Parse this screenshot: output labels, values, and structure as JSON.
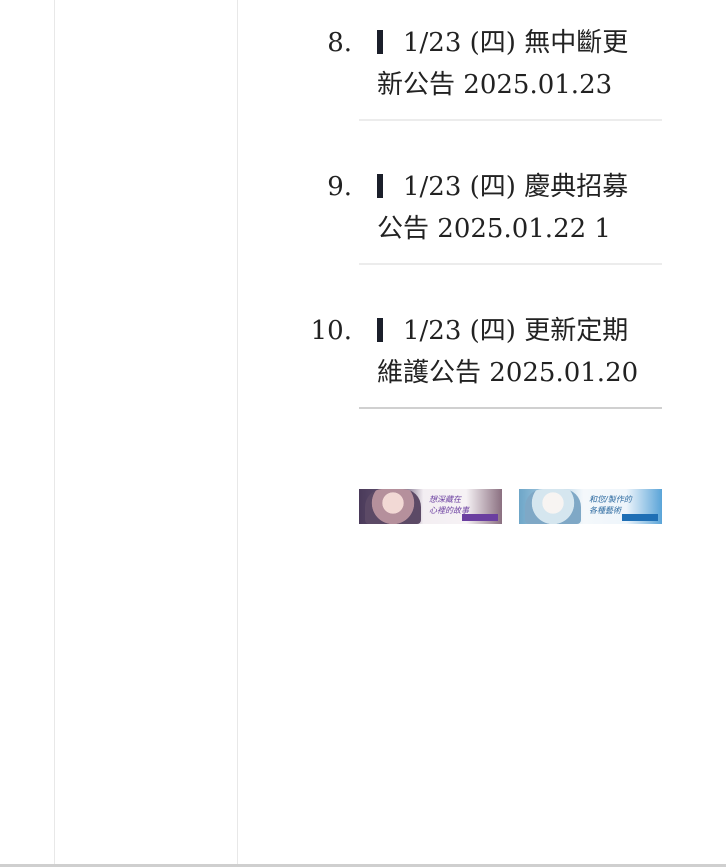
{
  "announcements": [
    {
      "number": "8.",
      "title": "1/23 (四) 無中斷更新公告",
      "date": "2025.01.23",
      "extra": ""
    },
    {
      "number": "9.",
      "title": "1/23 (四) 慶典招募公告",
      "date": "2025.01.22",
      "extra": "1"
    },
    {
      "number": "10.",
      "title": "1/23 (四) 更新定期維護公告",
      "date": "2025.01.20",
      "extra": ""
    }
  ],
  "banners": [
    {
      "icon": "promo-banner-character-story",
      "text_line1": "想深藏在",
      "text_line2": "心裡的故事",
      "accent": "#6b3fa0"
    },
    {
      "icon": "promo-banner-character-photo",
      "text_line1": "和您/製作的",
      "text_line2": "各種藝術",
      "accent": "#1f6fb5"
    }
  ],
  "colors": {
    "text": "#222222",
    "marker": "#1b1f2a",
    "divider": "#ececec"
  }
}
